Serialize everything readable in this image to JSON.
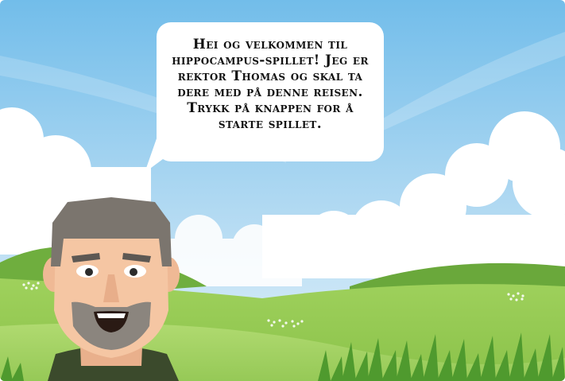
{
  "game": {
    "speech_bubble": {
      "text": "Hei og velkommen til hippocampus-spillet! Jeg er rektor Thomas og skal ta dere med på denne reisen. Trykk på knappen for å starte spillet."
    }
  },
  "colors": {
    "sky_top": "#7ec4ec",
    "sky_bottom": "#d8eef9",
    "cloud": "#ffffff",
    "hill_far": "#8cc44e",
    "hill_near": "#a6d465",
    "grass_dark": "#5a9e33",
    "skin": "#f4c7a5",
    "hair": "#7a736c",
    "beard": "#8a847d",
    "shirt": "#3c4a2e"
  },
  "icons": [
    "speech-bubble",
    "principal-avatar",
    "grass-tufts",
    "flower-patches"
  ]
}
